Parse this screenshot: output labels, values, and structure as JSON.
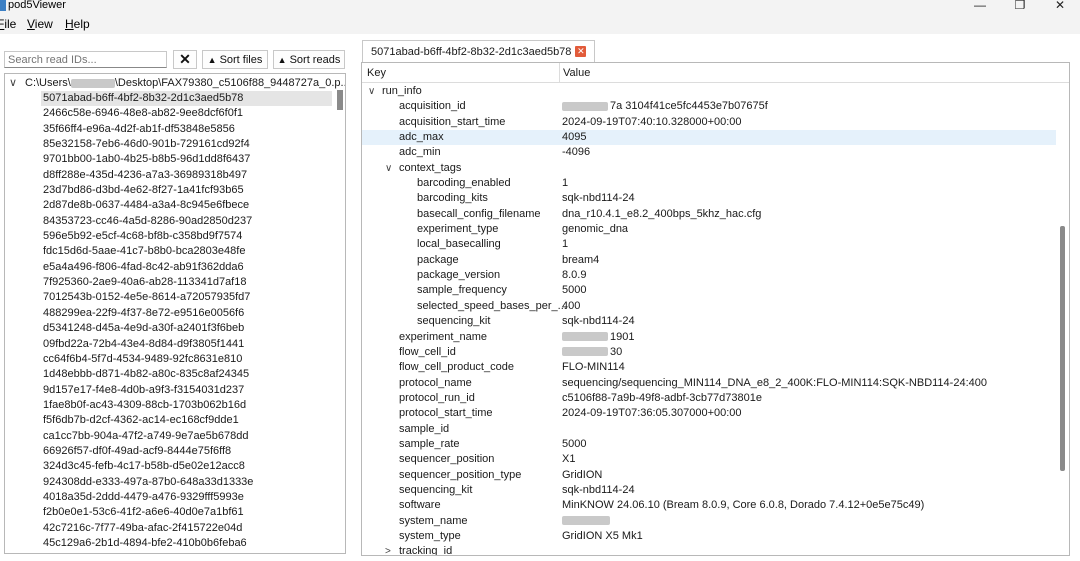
{
  "window": {
    "title": "pod5Viewer",
    "minimize": "—",
    "restore": "❐",
    "close": "✕"
  },
  "menu": [
    {
      "label": "File",
      "hot": "F",
      "rest": "ile"
    },
    {
      "label": "View",
      "hot": "V",
      "rest": "iew"
    },
    {
      "label": "Help",
      "hot": "H",
      "rest": "elp"
    }
  ],
  "toolbar": {
    "search_placeholder": "Search read IDs...",
    "clear_label": "✕",
    "sort_files_label": "Sort files",
    "sort_reads_label": "Sort reads"
  },
  "tree": {
    "root_prefix": "C:\\Users\\",
    "root_suffix": "\\Desktop\\FAX79380_c5106f88_9448727a_0.p...",
    "reads": [
      "5071abad-b6ff-4bf2-8b32-2d1c3aed5b78",
      "2466c58e-6946-48e8-ab82-9ee8dcf6f0f1",
      "35f66ff4-e96a-4d2f-ab1f-df53848e5856",
      "85e32158-7eb6-46d0-901b-729161cd92f4",
      "9701bb00-1ab0-4b25-b8b5-96d1dd8f6437",
      "d8ff288e-435d-4236-a7a3-36989318b497",
      "23d7bd86-d3bd-4e62-8f27-1a41fcf93b65",
      "2d87de8b-0637-4484-a3a4-8c945e6fbece",
      "84353723-cc46-4a5d-8286-90ad2850d237",
      "596e5b92-e5cf-4c68-bf8b-c358bd9f7574",
      "fdc15d6d-5aae-41c7-b8b0-bca2803e48fe",
      "e5a4a496-f806-4fad-8c42-ab91f362dda6",
      "7f925360-2ae9-40a6-ab28-113341d7af18",
      "7012543b-0152-4e5e-8614-a72057935fd7",
      "488299ea-22f9-4f37-8e72-e9516e0056f6",
      "d5341248-d45a-4e9d-a30f-a2401f3f6beb",
      "09fbd22a-72b4-43e4-8d84-d9f3805f1441",
      "cc64f6b4-5f7d-4534-9489-92fc8631e810",
      "1d48ebbb-d871-4b82-a80c-835c8af24345",
      "9d157e17-f4e8-4d0b-a9f3-f3154031d237",
      "1fae8b0f-ac43-4309-88cb-1703b062b16d",
      "f5f6db7b-d2cf-4362-ac14-ec168cf9dde1",
      "ca1cc7bb-904a-47f2-a749-9e7ae5b678dd",
      "66926f57-df0f-49ad-acf9-8444e75f6ff8",
      "324d3c45-fefb-4c17-b58b-d5e02e12acc8",
      "924308dd-e333-497a-87b0-648a33d1333e",
      "4018a35d-2ddd-4479-a476-9329fff5993e",
      "f2b0e0e1-53c6-41f2-a6e6-40d0e7a1bf61",
      "42c7216c-7f77-49ba-afac-2f415722e04d",
      "45c129a6-2b1d-4894-bfe2-410b0b6feba6"
    ]
  },
  "tab": {
    "label": "5071abad-b6ff-4bf2-8b32-2d1c3aed5b78",
    "close": "✕"
  },
  "details": {
    "key_header": "Key",
    "value_header": "Value",
    "rows": [
      {
        "key": "run_info",
        "value": "",
        "level": 0,
        "chevron": "∨"
      },
      {
        "key": "acquisition_id",
        "value": "7a 3104f41ce5fc4453e7b07675f",
        "level": 1,
        "redacted": true
      },
      {
        "key": "acquisition_start_time",
        "value": "2024-09-19T07:40:10.328000+00:00",
        "level": 1
      },
      {
        "key": "adc_max",
        "value": "4095",
        "level": 1,
        "highlight": true
      },
      {
        "key": "adc_min",
        "value": "-4096",
        "level": 1
      },
      {
        "key": "context_tags",
        "value": "",
        "level": 1,
        "chevron": "∨"
      },
      {
        "key": "barcoding_enabled",
        "value": "1",
        "level": 2
      },
      {
        "key": "barcoding_kits",
        "value": "sqk-nbd114-24",
        "level": 2
      },
      {
        "key": "basecall_config_filename",
        "value": "dna_r10.4.1_e8.2_400bps_5khz_hac.cfg",
        "level": 2
      },
      {
        "key": "experiment_type",
        "value": "genomic_dna",
        "level": 2
      },
      {
        "key": "local_basecalling",
        "value": "1",
        "level": 2
      },
      {
        "key": "package",
        "value": "bream4",
        "level": 2
      },
      {
        "key": "package_version",
        "value": "8.0.9",
        "level": 2
      },
      {
        "key": "sample_frequency",
        "value": "5000",
        "level": 2
      },
      {
        "key": "selected_speed_bases_per_...",
        "value": "400",
        "level": 2
      },
      {
        "key": "sequencing_kit",
        "value": "sqk-nbd114-24",
        "level": 2
      },
      {
        "key": "experiment_name",
        "value": "1901",
        "level": 1,
        "redacted": true
      },
      {
        "key": "flow_cell_id",
        "value": "30",
        "level": 1,
        "redacted": true
      },
      {
        "key": "flow_cell_product_code",
        "value": "FLO-MIN114",
        "level": 1
      },
      {
        "key": "protocol_name",
        "value": "sequencing/sequencing_MIN114_DNA_e8_2_400K:FLO-MIN114:SQK-NBD114-24:400",
        "level": 1
      },
      {
        "key": "protocol_run_id",
        "value": "c5106f88-7a9b-49f8-adbf-3cb77d73801e",
        "level": 1
      },
      {
        "key": "protocol_start_time",
        "value": "2024-09-19T07:36:05.307000+00:00",
        "level": 1
      },
      {
        "key": "sample_id",
        "value": "",
        "level": 1
      },
      {
        "key": "sample_rate",
        "value": "5000",
        "level": 1
      },
      {
        "key": "sequencer_position",
        "value": "X1",
        "level": 1
      },
      {
        "key": "sequencer_position_type",
        "value": "GridION",
        "level": 1
      },
      {
        "key": "sequencing_kit",
        "value": "sqk-nbd114-24",
        "level": 1
      },
      {
        "key": "software",
        "value": "MinKNOW 24.06.10 (Bream 8.0.9, Core 6.0.8, Dorado 7.4.12+0e5e75c49)",
        "level": 1
      },
      {
        "key": "system_name",
        "value": "",
        "level": 1,
        "redacted": true
      },
      {
        "key": "system_type",
        "value": "GridION X5 Mk1",
        "level": 1
      },
      {
        "key": "tracking_id",
        "value": "",
        "level": 1,
        "chevron": ">"
      }
    ]
  },
  "colors": {
    "selection": "#e5e5e5",
    "highlight": "#e5f1fb",
    "tab_close": "#e25b3a",
    "chrome": "#f3f3f3"
  }
}
